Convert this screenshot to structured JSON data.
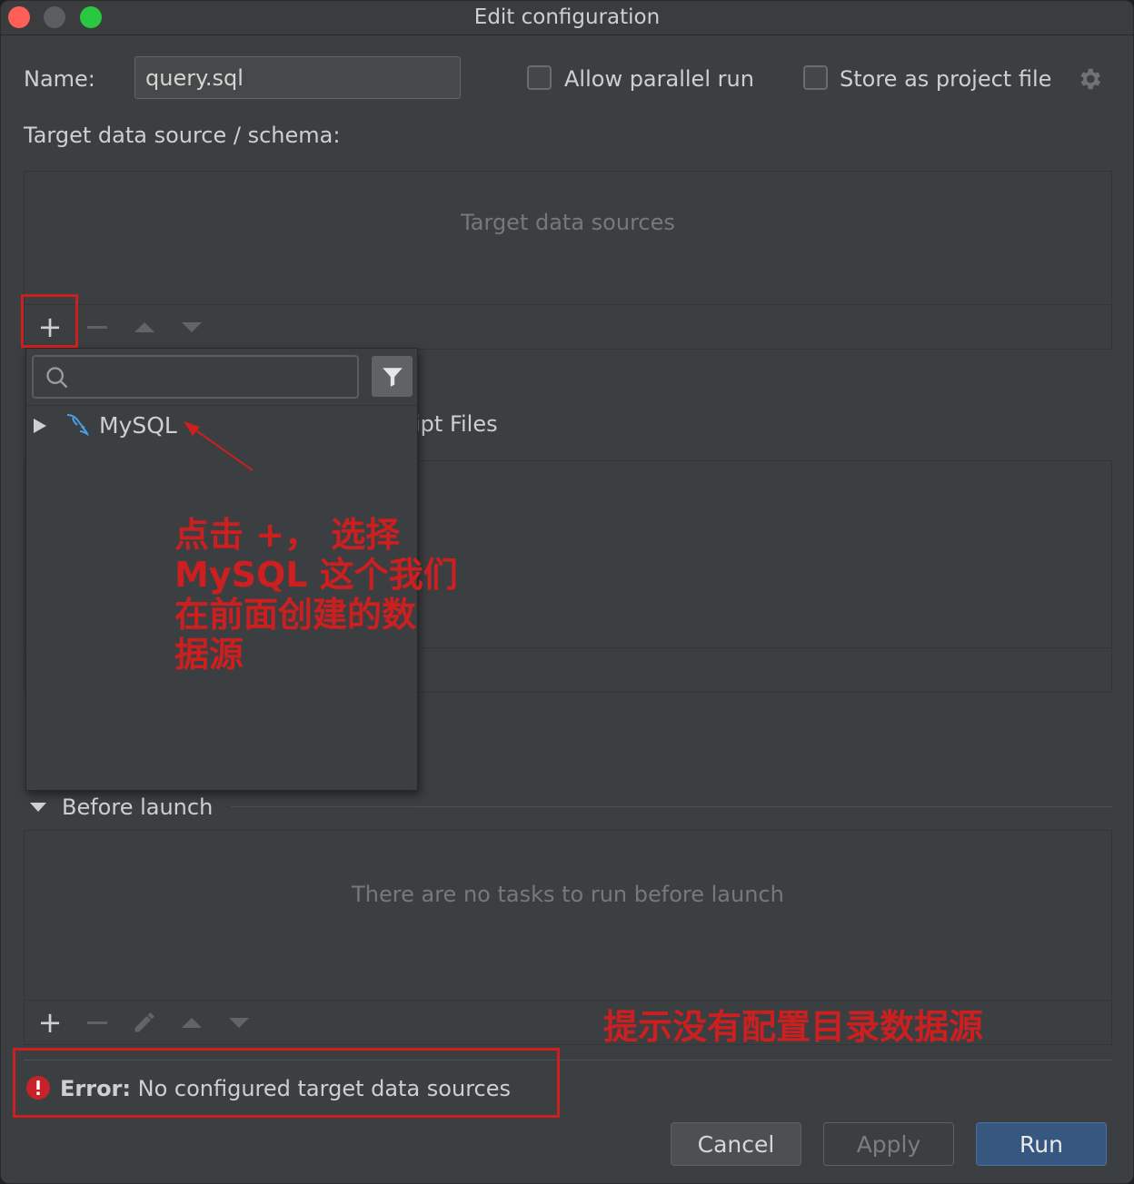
{
  "window": {
    "title": "Edit configuration"
  },
  "form": {
    "name_label": "Name:",
    "name_value": "query.sql",
    "allow_parallel_label": "Allow parallel run",
    "store_project_label": "Store as project file",
    "target_label": "Target data source / schema:"
  },
  "target_panel": {
    "empty_text": "Target data sources"
  },
  "popup": {
    "search_placeholder": "",
    "items": [
      {
        "label": "MySQL",
        "icon": "mysql-dolphin-icon",
        "expanded": false
      }
    ]
  },
  "script_files": {
    "label_partial": "ipt Files"
  },
  "before_launch": {
    "title": "Before launch",
    "empty_text": "There are no tasks to run before launch"
  },
  "error": {
    "prefix": "Error:",
    "message": " No configured target data sources"
  },
  "annotations": {
    "popup_note_lines": [
      "点击 +，  选择",
      "MySQL 这个我们",
      "在前面创建的数",
      "据源"
    ],
    "error_note": "提示没有配置目录数据源",
    "color": "#cc1f1f"
  },
  "buttons": {
    "cancel": "Cancel",
    "apply": "Apply",
    "run": "Run"
  },
  "colors": {
    "accent": "#365880",
    "error_icon": "#c7222a",
    "mysql_icon": "#4a9ee6"
  }
}
